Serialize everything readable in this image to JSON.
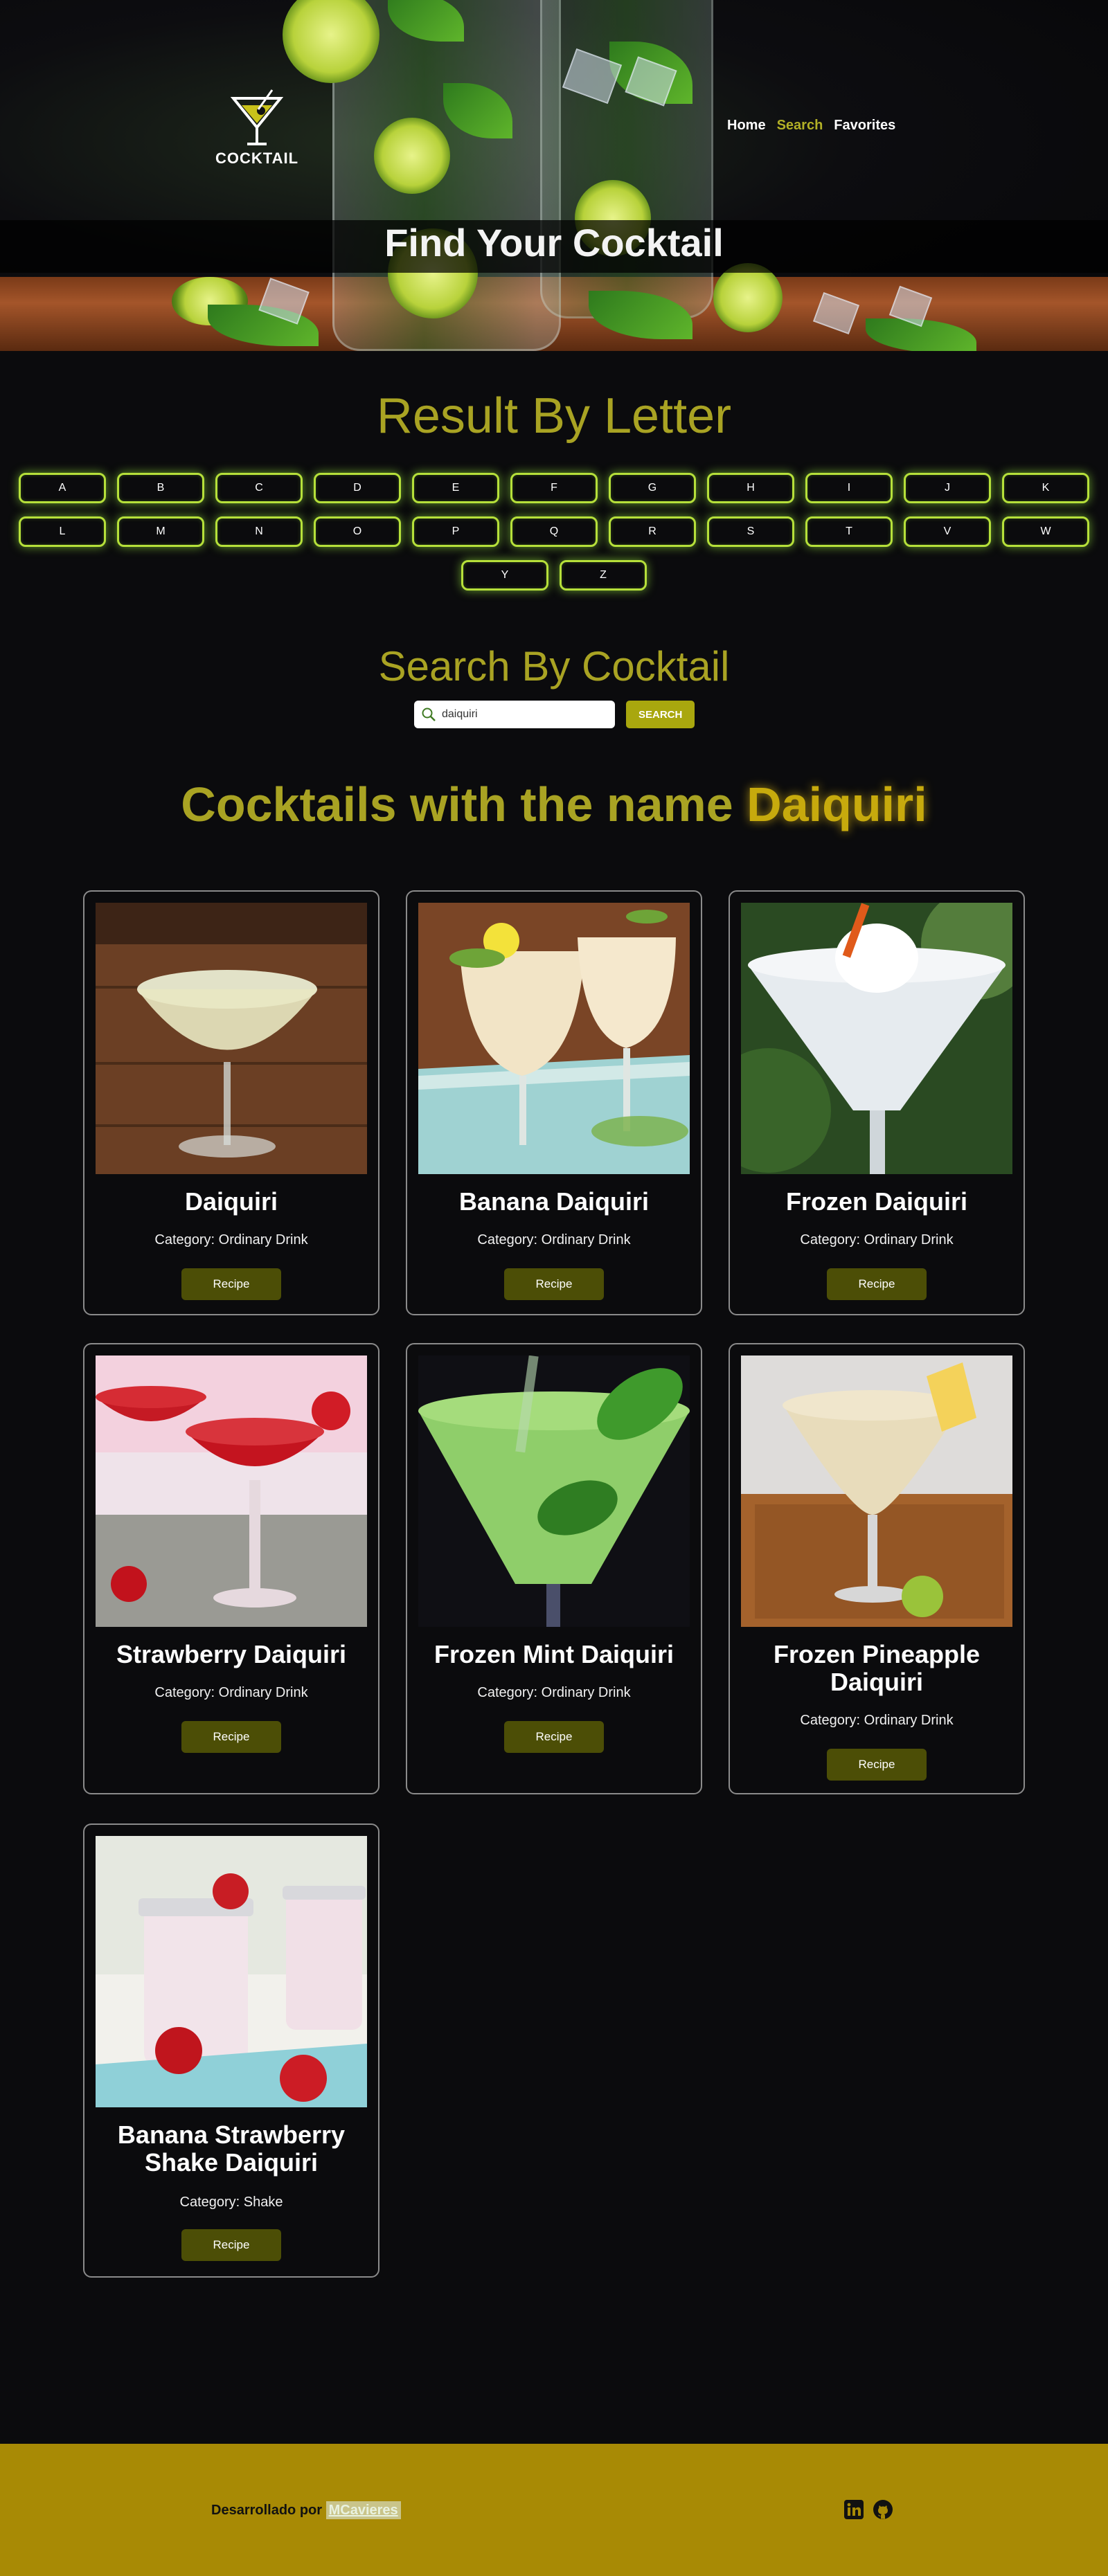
{
  "header": {
    "logo_text": "COCKTAIL",
    "nav": [
      {
        "label": "Home",
        "active": false
      },
      {
        "label": "Search",
        "active": true
      },
      {
        "label": "Favorites",
        "active": false
      }
    ],
    "hero_title": "Find Your Cocktail"
  },
  "letters_section": {
    "title": "Result By Letter",
    "rows": [
      [
        "A",
        "B",
        "C",
        "D",
        "E",
        "F",
        "G",
        "H",
        "I",
        "J",
        "K"
      ],
      [
        "L",
        "M",
        "N",
        "O",
        "P",
        "Q",
        "R",
        "S",
        "T",
        "V",
        "W"
      ],
      [
        "Y",
        "Z"
      ]
    ]
  },
  "search_section": {
    "title": "Search By Cocktail",
    "input_value": "daiquiri",
    "button_label": "SEARCH"
  },
  "results": {
    "title_prefix": "Cocktails with the name",
    "query_highlight": "Daiquiri",
    "cards": [
      {
        "name": "Daiquiri",
        "category": "Category: Ordinary Drink",
        "button": "Recipe"
      },
      {
        "name": "Banana Daiquiri",
        "category": "Category: Ordinary Drink",
        "button": "Recipe"
      },
      {
        "name": "Frozen Daiquiri",
        "category": "Category: Ordinary Drink",
        "button": "Recipe"
      },
      {
        "name": "Strawberry Daiquiri",
        "category": "Category: Ordinary Drink",
        "button": "Recipe"
      },
      {
        "name": "Frozen Mint Daiquiri",
        "category": "Category: Ordinary Drink",
        "button": "Recipe"
      },
      {
        "name": "Frozen Pineapple Daiquiri",
        "category": "Category: Ordinary Drink",
        "button": "Recipe"
      },
      {
        "name": "Banana Strawberry Shake Daiquiri",
        "category": "Category: Shake",
        "button": "Recipe"
      }
    ]
  },
  "footer": {
    "developed_by": "Desarrollado por",
    "developer_name": "MCavieres",
    "icons": [
      "linkedin-icon",
      "github-icon"
    ]
  },
  "colors": {
    "accent_olive": "#a9a323",
    "nav_active": "#b2b026",
    "letter_glow": "#b6e03a",
    "recipe_button": "#4c4e06",
    "footer_bg": "#a88a05"
  }
}
